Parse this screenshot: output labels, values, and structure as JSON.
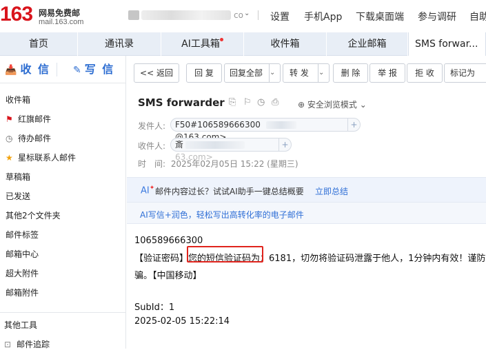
{
  "header": {
    "logo_number": "163",
    "logo_name": "网易免费邮",
    "logo_domain": "mail.163.com",
    "account_tail": "co",
    "links": [
      "设置",
      "手机App",
      "下载桌面端",
      "参与调研",
      "自助"
    ]
  },
  "tabs": [
    {
      "label": "首页"
    },
    {
      "label": "通讯录"
    },
    {
      "label": "AI工具箱",
      "dot": true
    },
    {
      "label": "收件箱"
    },
    {
      "label": "企业邮箱"
    },
    {
      "label": "SMS forwar...",
      "close": "×"
    }
  ],
  "sidebar": {
    "receive_label": "收 信",
    "write_label": "写 信",
    "items": [
      {
        "label": "收件箱"
      },
      {
        "label": "红旗邮件",
        "icon": "flag-icon"
      },
      {
        "label": "待办邮件",
        "icon": "clock-icon"
      },
      {
        "label": "星标联系人邮件",
        "icon": "star-icon"
      },
      {
        "label": "草稿箱"
      },
      {
        "label": "已发送"
      },
      {
        "label": "其他2个文件夹"
      },
      {
        "label": "邮件标签"
      },
      {
        "label": "邮箱中心"
      },
      {
        "label": "超大附件"
      },
      {
        "label": "邮箱附件"
      },
      {
        "label": "其他工具"
      },
      {
        "label": "邮件追踪",
        "icon": "tracking-icon"
      }
    ]
  },
  "toolbar": {
    "back": "<< 返回",
    "reply": "回 复",
    "reply_all": "回复全部",
    "forward": "转 发",
    "delete": "删 除",
    "report": "举 报",
    "reject": "拒 收",
    "mark_as": "标记为"
  },
  "email": {
    "subject": "SMS forwarder",
    "safe_mode": "安全浏览模式",
    "from_label": "发件人:",
    "from_value": "F50#106589666300",
    "from_domain": "@163.com>",
    "to_label": "收件人:",
    "to_prefix": "斎",
    "to_domain": "63.com>",
    "time_label": "时　间:",
    "time_value": "2025年02月05日 15:22 (星期三)"
  },
  "ai_banner": {
    "logo": "AI",
    "text": "邮件内容过长？试试AI助手一键总结概要",
    "link": "立即总结"
  },
  "ai_banner2": {
    "text": "AI写信+润色，轻松写出高转化率的电子邮件"
  },
  "body": {
    "line1": "106589666300",
    "line2": "【验证密码】您的短信验证码为：6181，切勿将验证码泄露于他人，1分钟内有效！谨防诈",
    "line3": "骗。【中国移动】",
    "line4": "SubId：1",
    "line5": "2025-02-05 15:22:14"
  },
  "colors": {
    "accent": "#2b6cd1",
    "highlight_box": "#e0231c",
    "logo_red": "#d9141c"
  }
}
